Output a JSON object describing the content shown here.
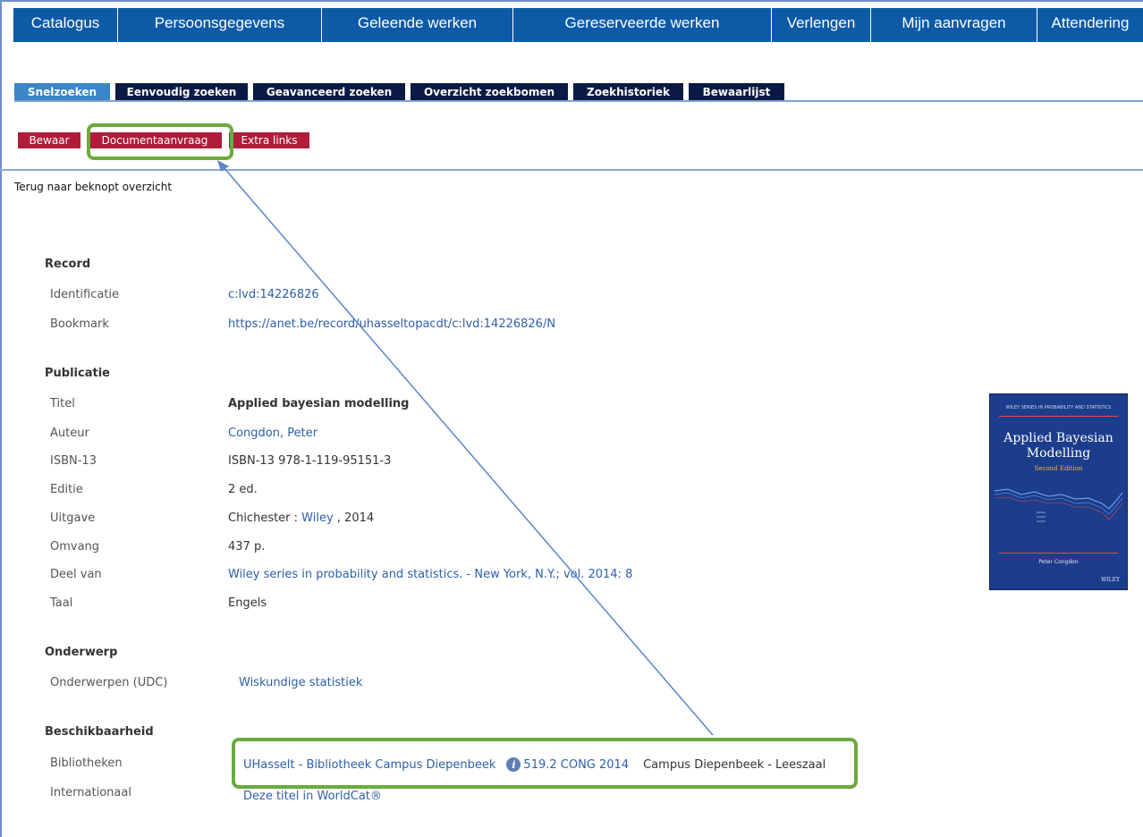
{
  "topnav": [
    "Catalogus",
    "Persoonsgegevens",
    "Geleende werken",
    "Gereserveerde werken",
    "Verlengen",
    "Mijn aanvragen",
    "Attendering"
  ],
  "subtabs": [
    "Snelzoeken",
    "Eenvoudig zoeken",
    "Geavanceerd zoeken",
    "Overzicht zoekbomen",
    "Zoekhistoriek",
    "Bewaarlijst"
  ],
  "actions": [
    "Bewaar",
    "Documentaanvraag",
    "Extra links"
  ],
  "back_link": "Terug naar beknopt overzicht",
  "record": {
    "section": "Record",
    "identificatie_label": "Identificatie",
    "identificatie_value": "c:lvd:14226826",
    "bookmark_label": "Bookmark",
    "bookmark_value": "https://anet.be/record/uhasseltopacdt/c:lvd:14226826/N"
  },
  "publicatie": {
    "section": "Publicatie",
    "titel_label": "Titel",
    "titel_value": "Applied bayesian modelling",
    "auteur_label": "Auteur",
    "auteur_value": "Congdon, Peter",
    "isbn_label": "ISBN-13",
    "isbn_value": "ISBN-13 978-1-119-95151-3",
    "editie_label": "Editie",
    "editie_value": "2 ed.",
    "uitgave_label": "Uitgave",
    "uitgave_place": "Chichester : ",
    "uitgave_publisher": "Wiley",
    "uitgave_year": " , 2014",
    "omvang_label": "Omvang",
    "omvang_value": "437 p.",
    "deelvan_label": "Deel van",
    "deelvan_value": "Wiley series in probability and statistics. - New York, N.Y.; vol. 2014: 8",
    "taal_label": "Taal",
    "taal_value": "Engels"
  },
  "onderwerp": {
    "section": "Onderwerp",
    "udc_label": "Onderwerpen (UDC)",
    "udc_value": "Wiskundige statistiek"
  },
  "beschikbaarheid": {
    "section": "Beschikbaarheid",
    "bibliotheken_label": "Bibliotheken",
    "library": "UHasselt - Bibliotheek Campus Diepenbeek",
    "callnumber": "519.2 CONG 2014",
    "location": "Campus Diepenbeek - Leeszaal",
    "internationaal_label": "Internationaal",
    "worldcat": "Deze titel in WorldCat®"
  },
  "cover": {
    "series": "WILEY SERIES IN PROBABILITY AND STATISTICS",
    "title_line1": "Applied Bayesian",
    "title_line2": "Modelling",
    "edition": "Second Edition",
    "author": "Peter Congdon",
    "publisher": "WILEY"
  },
  "colors": {
    "nav_blue": "#0d5aa7",
    "tab_navy": "#0a1a44",
    "tab_active": "#3a86c8",
    "action_red": "#b01c3a",
    "highlight_green": "#6aab3c",
    "arrow_blue": "#5b86c9",
    "link_blue": "#2e5fa8"
  }
}
